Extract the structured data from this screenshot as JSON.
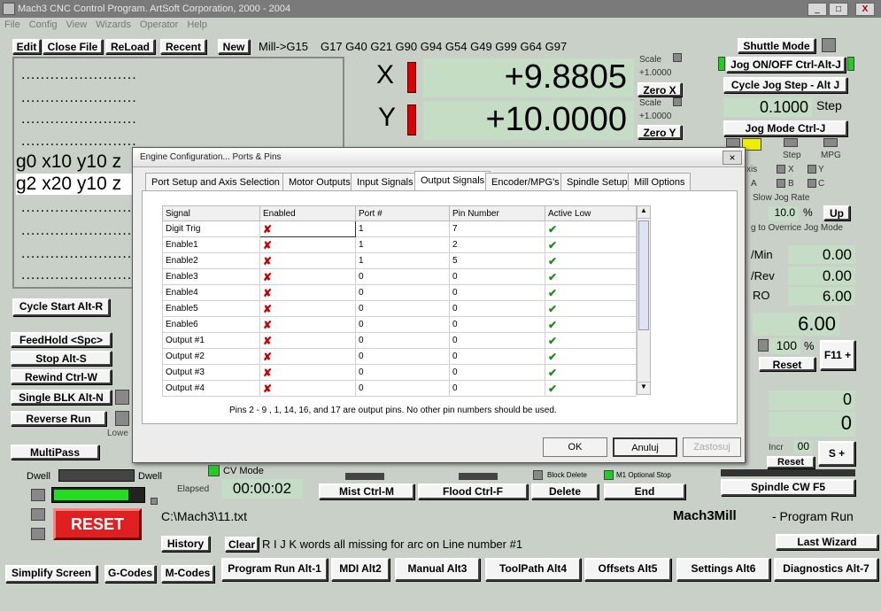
{
  "window": {
    "title": "Mach3 CNC Control Program. ArtSoft Corporation, 2000 - 2004",
    "min": "_",
    "max": "□",
    "close": "X"
  },
  "menu": [
    "File",
    "Config",
    "View",
    "Wizards",
    "Operator",
    "Help"
  ],
  "toolbar": {
    "edit": "Edit",
    "close_file": "Close File",
    "reload": "ReLoad",
    "recent": "Recent",
    "new": "New",
    "modal_label": "Mill->G15",
    "modal_codes": "G17 G40 G21 G90 G94 G54 G49 G99 G64 G97"
  },
  "gcode": {
    "dots": "........................",
    "line1": "g0 x10 y10 z",
    "line2": "g2 x20 y10 z"
  },
  "dro": {
    "x_label": "X",
    "x_value": "+9.8805",
    "y_label": "Y",
    "y_value": "+10.0000",
    "scale": "Scale",
    "x_scale": "+1.0000",
    "y_scale": "+1.0000",
    "zero_x": "Zero X",
    "zero_y": "Zero Y"
  },
  "jog": {
    "shuttle": "Shuttle Mode",
    "jog_onoff": "Jog ON/OFF Ctrl-Alt-J",
    "cycle_step": "Cycle Jog Step - Alt J",
    "step_value": "0.1000",
    "step_label": "Step",
    "jog_mode": "Jog Mode Ctrl-J",
    "step": "Step",
    "mpg": "MPG",
    "axis": "xis",
    "x": "X",
    "y": "Y",
    "a": "A",
    "b": "B",
    "c": "C",
    "slow_rate": "Slow Jog Rate",
    "rate_value": "10.0",
    "pct": "%",
    "up": "Up",
    "override": "g to Overrice Jog Mode"
  },
  "feed": {
    "umin_label": "/Min",
    "umin": "0.00",
    "urev_label": "/Rev",
    "urev": "0.00",
    "fro_label": "RO",
    "fro": "6.00",
    "feed_big": "6.00",
    "pct": "100",
    "pct_sign": "%",
    "reset": "Reset",
    "f11": "F11 +"
  },
  "spindle": {
    "val1": "0",
    "val2": "0",
    "incr": "Incr",
    "incr_val": "00",
    "reset": "Reset",
    "splus": "S +",
    "cw": "Spindle CW F5"
  },
  "left_buttons": {
    "cycle_start": "Cycle Start Alt-R",
    "feedhold": "FeedHold <Spc>",
    "stop": "Stop Alt-S",
    "rewind": "Rewind Ctrl-W",
    "single_blk": "Single BLK Alt-N",
    "reverse_run": "Reverse Run",
    "lower": "Lowe",
    "multipass": "MultiPass"
  },
  "bottom": {
    "dwell": "Dwell",
    "dwell2": "Dwell",
    "cv_mode": "CV Mode",
    "elapsed": "Elapsed",
    "time": "00:00:02",
    "mist": "Mist Ctrl-M",
    "flood": "Flood Ctrl-F",
    "block_delete": "Block Delete",
    "m1_stop": "M1 Optional Stop",
    "delete": "Delete",
    "end": "End",
    "reset": "RESET",
    "filepath": "C:\\Mach3\\11.txt",
    "product": "Mach3Mill",
    "screen_name": "- Program Run",
    "history": "History",
    "clear": "Clear",
    "status": "R I J K words all missing for arc on Line number #1",
    "last_wizard": "Last Wizard"
  },
  "nav": [
    "Simplify Screen",
    "G-Codes",
    "M-Codes",
    "Program Run Alt-1",
    "MDI Alt2",
    "Manual Alt3",
    "ToolPath Alt4",
    "Offsets Alt5",
    "Settings Alt6",
    "Diagnostics Alt-7"
  ],
  "dialog": {
    "title": "Engine Configuration... Ports & Pins",
    "close": "×",
    "tabs": [
      "Port Setup and Axis Selection",
      "Motor Outputs",
      "Input Signals",
      "Output Signals",
      "Encoder/MPG's",
      "Spindle Setup",
      "Mill Options"
    ],
    "columns": [
      "Signal",
      "Enabled",
      "Port #",
      "Pin Number",
      "Active Low"
    ],
    "rows": [
      {
        "signal": "Digit Trig",
        "enabled": "✘",
        "port": "1",
        "pin": "7",
        "active": "✔"
      },
      {
        "signal": "Enable1",
        "enabled": "✘",
        "port": "1",
        "pin": "2",
        "active": "✔"
      },
      {
        "signal": "Enable2",
        "enabled": "✘",
        "port": "1",
        "pin": "5",
        "active": "✔"
      },
      {
        "signal": "Enable3",
        "enabled": "✘",
        "port": "0",
        "pin": "0",
        "active": "✔"
      },
      {
        "signal": "Enable4",
        "enabled": "✘",
        "port": "0",
        "pin": "0",
        "active": "✔"
      },
      {
        "signal": "Enable5",
        "enabled": "✘",
        "port": "0",
        "pin": "0",
        "active": "✔"
      },
      {
        "signal": "Enable6",
        "enabled": "✘",
        "port": "0",
        "pin": "0",
        "active": "✔"
      },
      {
        "signal": "Output #1",
        "enabled": "✘",
        "port": "0",
        "pin": "0",
        "active": "✔"
      },
      {
        "signal": "Output #2",
        "enabled": "✘",
        "port": "0",
        "pin": "0",
        "active": "✔"
      },
      {
        "signal": "Output #3",
        "enabled": "✘",
        "port": "0",
        "pin": "0",
        "active": "✔"
      },
      {
        "signal": "Output #4",
        "enabled": "✘",
        "port": "0",
        "pin": "0",
        "active": "✔"
      }
    ],
    "note": "Pins 2 - 9 , 1, 14, 16, and 17 are output pins. No other pin numbers should be used.",
    "ok": "OK",
    "cancel": "Anuluj",
    "apply": "Zastosuj"
  }
}
